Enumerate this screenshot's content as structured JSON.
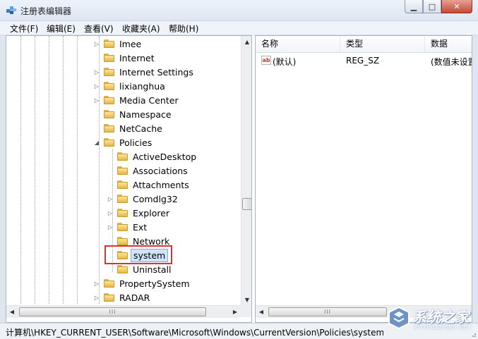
{
  "window": {
    "title": "注册表编辑器",
    "minimize_glyph": "▁",
    "maximize_glyph": "□",
    "close_glyph": "✕"
  },
  "menu": [
    {
      "label": "文件(F)"
    },
    {
      "label": "编辑(E)"
    },
    {
      "label": "查看(V)"
    },
    {
      "label": "收藏夹(A)"
    },
    {
      "label": "帮助(H)"
    }
  ],
  "tree": [
    {
      "label": "Imee",
      "expander": "▷"
    },
    {
      "label": "Internet",
      "expander": ""
    },
    {
      "label": "Internet Settings",
      "expander": "▷"
    },
    {
      "label": "lixianghua",
      "expander": "▷"
    },
    {
      "label": "Media Center",
      "expander": "▷"
    },
    {
      "label": "Namespace",
      "expander": ""
    },
    {
      "label": "NetCache",
      "expander": ""
    },
    {
      "label": "Policies",
      "expander": "◢"
    },
    {
      "label": "ActiveDesktop",
      "expander": ""
    },
    {
      "label": "Associations",
      "expander": ""
    },
    {
      "label": "Attachments",
      "expander": ""
    },
    {
      "label": "Comdlg32",
      "expander": "▷"
    },
    {
      "label": "Explorer",
      "expander": "▷"
    },
    {
      "label": "Ext",
      "expander": "▷"
    },
    {
      "label": "Network",
      "expander": ""
    },
    {
      "label": "system",
      "expander": "",
      "selected": true
    },
    {
      "label": "Uninstall",
      "expander": ""
    },
    {
      "label": "PropertySystem",
      "expander": "▷"
    },
    {
      "label": "RADAR",
      "expander": "▷"
    }
  ],
  "scroll": {
    "tree_h_thumb_glyph": "III",
    "list_h_thumb_glyph": "III",
    "left_glyph": "◀",
    "right_glyph": "▶",
    "up_glyph": "▲",
    "down_glyph": "▼"
  },
  "list": {
    "columns": [
      "名称",
      "类型",
      "数据"
    ],
    "rows": [
      {
        "icon": "ab",
        "name": "(默认)",
        "type": "REG_SZ",
        "data": "(数值未设置"
      }
    ]
  },
  "status": {
    "path": "计算机\\HKEY_CURRENT_USER\\Software\\Microsoft\\Windows\\CurrentVersion\\Policies\\system"
  },
  "watermark": {
    "text": "系统之家",
    "sub": "XITONGZHIJIA.NET"
  },
  "colors": {
    "selection": "#cfe3fb",
    "highlight_box": "#e03030",
    "folder": "#e6b64a"
  }
}
